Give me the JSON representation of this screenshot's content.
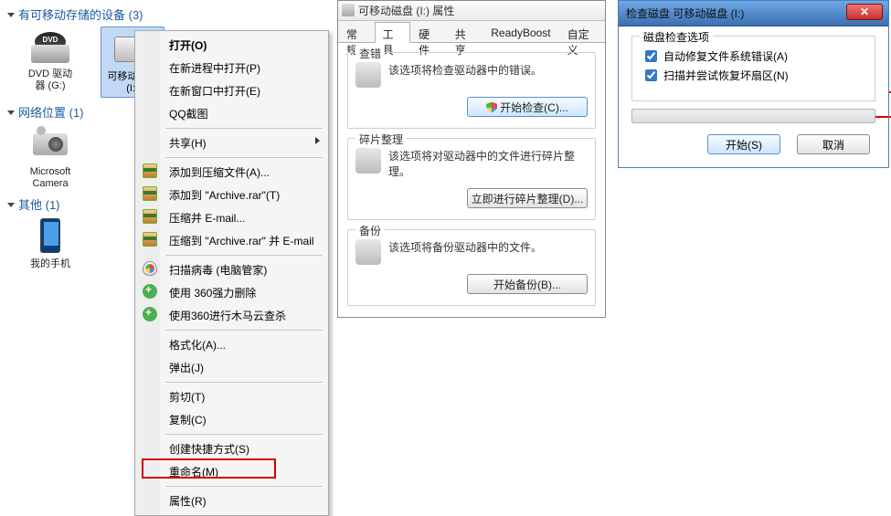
{
  "explorer": {
    "cat_removable": "有可移动存储的设备 (3)",
    "cat_network": "网络位置 (1)",
    "cat_other": "其他 (1)",
    "dvd_label_l1": "DVD 驱动",
    "dvd_label_l2": "器 (G:)",
    "usb_label_l1": "可移动磁盘",
    "usb_label_l2": "(I:)",
    "camera_label_l1": "Microsoft",
    "camera_label_l2": "Camera",
    "phone_label": "我的手机"
  },
  "ctx": {
    "open": "打开(O)",
    "new_process": "在新进程中打开(P)",
    "new_window": "在新窗口中打开(E)",
    "qq_capture": "QQ截图",
    "share": "共享(H)",
    "add_archive": "添加到压缩文件(A)...",
    "add_archive_rar": "添加到 \"Archive.rar\"(T)",
    "compress_email": "压缩并 E-mail...",
    "compress_email_rar": "压缩到 \"Archive.rar\" 并 E-mail",
    "scan_virus": "扫描病毒 (电脑管家)",
    "force_delete_360": "使用 360强力删除",
    "trojan_360": "使用360进行木马云查杀",
    "format": "格式化(A)...",
    "eject": "弹出(J)",
    "cut": "剪切(T)",
    "copy": "复制(C)",
    "shortcut": "创建快捷方式(S)",
    "rename": "重命名(M)",
    "properties": "属性(R)"
  },
  "prop": {
    "title": "可移动磁盘 (I:) 属性",
    "tab_general": "常规",
    "tab_tools": "工具",
    "tab_hardware": "硬件",
    "tab_share": "共享",
    "tab_readyboost": "ReadyBoost",
    "tab_custom": "自定义",
    "grp_check": "查错",
    "grp_check_text": "该选项将检查驱动器中的错误。",
    "btn_check": "开始检查(C)...",
    "grp_defrag": "碎片整理",
    "grp_defrag_text": "该选项将对驱动器中的文件进行碎片整理。",
    "btn_defrag": "立即进行碎片整理(D)...",
    "grp_backup": "备份",
    "grp_backup_text": "该选项将备份驱动器中的文件。",
    "btn_backup": "开始备份(B)..."
  },
  "chk": {
    "title": "检查磁盘 可移动磁盘 (I:)",
    "grp_options": "磁盘检查选项",
    "opt_autofix": "自动修复文件系统错误(A)",
    "opt_scan_bad": "扫描并尝试恢复坏扇区(N)",
    "btn_start": "开始(S)",
    "btn_cancel": "取消"
  }
}
